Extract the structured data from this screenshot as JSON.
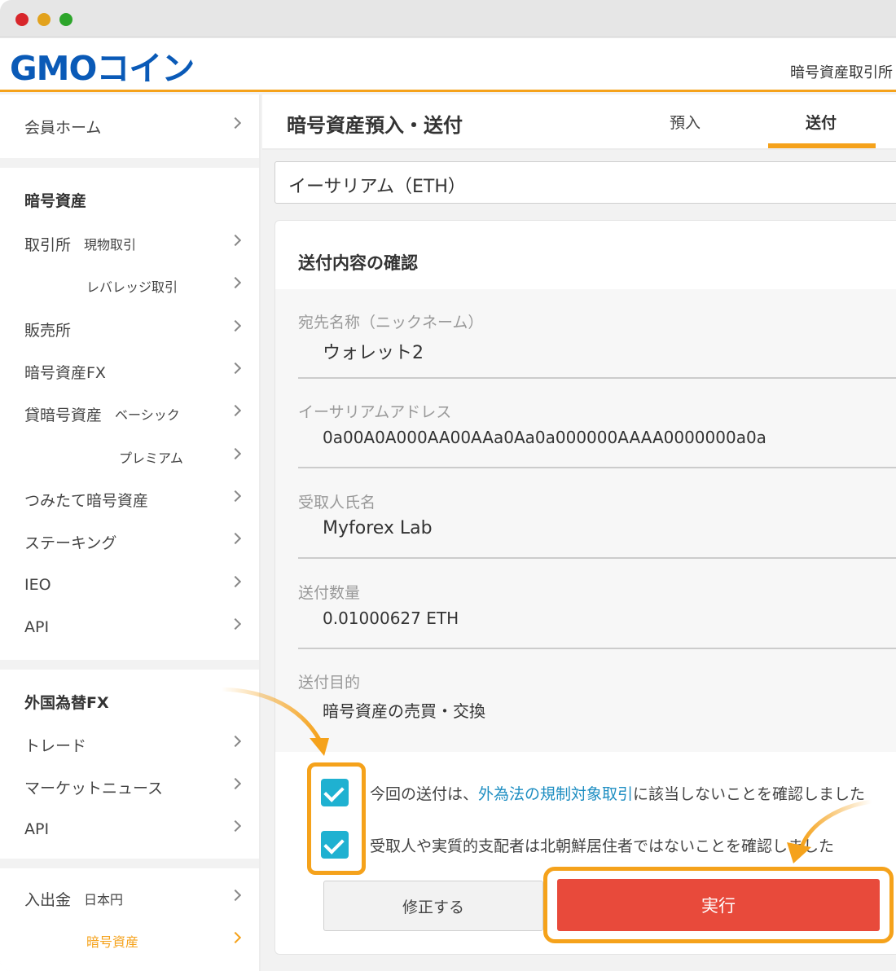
{
  "window": {
    "traffic_lights": [
      "close",
      "minimize",
      "zoom"
    ]
  },
  "header": {
    "logo_text": "GMOコイン",
    "top_link": "暗号資産取引所"
  },
  "sidebar": {
    "member_home": "会員ホーム",
    "crypto_heading": "暗号資産",
    "exchange": "取引所",
    "exchange_spot": "現物取引",
    "exchange_leverage": "レバレッジ取引",
    "sales": "販売所",
    "crypto_fx": "暗号資産FX",
    "lending": "貸暗号資産",
    "lending_basic": "ベーシック",
    "lending_premium": "プレミアム",
    "tsumitate": "つみたて暗号資産",
    "staking": "ステーキング",
    "ieo": "IEO",
    "api": "API",
    "fx_heading": "外国為替FX",
    "trade": "トレード",
    "market_news": "マーケットニュース",
    "fx_api": "API",
    "deposit_withdraw": "入出金",
    "jpy": "日本円",
    "crypto": "暗号資産"
  },
  "main": {
    "page_title": "暗号資産預入・送付",
    "tabs": [
      {
        "label": "預入"
      },
      {
        "label": "送付",
        "active": true
      }
    ],
    "currency_select": "イーサリアム（ETH）",
    "card_title": "送付内容の確認",
    "fields": [
      {
        "label": "宛先名称（ニックネーム）",
        "value": "ウォレット2"
      },
      {
        "label": "イーサリアムアドレス",
        "value": "0a00A0A000AA00AAa0Aa0a000000AAAA0000000a0a"
      },
      {
        "label": "受取人氏名",
        "value": "Myforex Lab"
      },
      {
        "label": "送付数量",
        "value": "0.01000627 ETH"
      },
      {
        "label": "送付目的",
        "value": "暗号資産の売買・交換"
      }
    ],
    "checks": [
      {
        "prefix": "今回の送付は、",
        "link": "外為法の規制対象取引",
        "suffix": "に該当しないことを確認しました",
        "checked": true
      },
      {
        "text": "受取人や実質的支配者は北朝鮮居住者ではないことを確認しました",
        "checked": true
      }
    ],
    "fix_button": "修正する",
    "execute_button": "実行"
  },
  "colors": {
    "accent": "#f5a21b",
    "brand_blue": "#0a5ab7",
    "checkbox": "#1fb1d1",
    "execute": "#e84a3b",
    "link": "#1e8ec2"
  }
}
